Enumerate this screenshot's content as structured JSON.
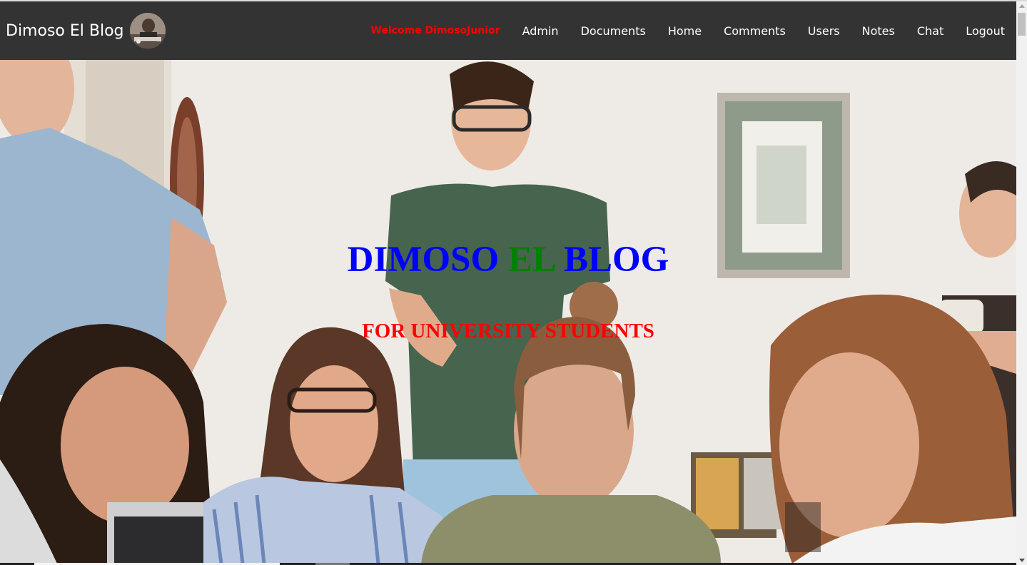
{
  "header": {
    "brand": "Dimoso El Blog",
    "welcome": "Welcome DimosoJunior",
    "nav": [
      "Admin",
      "Documents",
      "Home",
      "Comments",
      "Users",
      "Notes",
      "Chat",
      "Logout"
    ]
  },
  "hero": {
    "title_part1": "DIMOSO",
    "title_part2": "EL",
    "title_part3": "BLOG",
    "subtitle": "FOR UNIVERSITY STUDENTS"
  },
  "colors": {
    "navbar": "#333333",
    "welcome": "#ff0000",
    "title_blue": "#0000ff",
    "title_green": "#008000",
    "subtitle": "#ff0000"
  }
}
